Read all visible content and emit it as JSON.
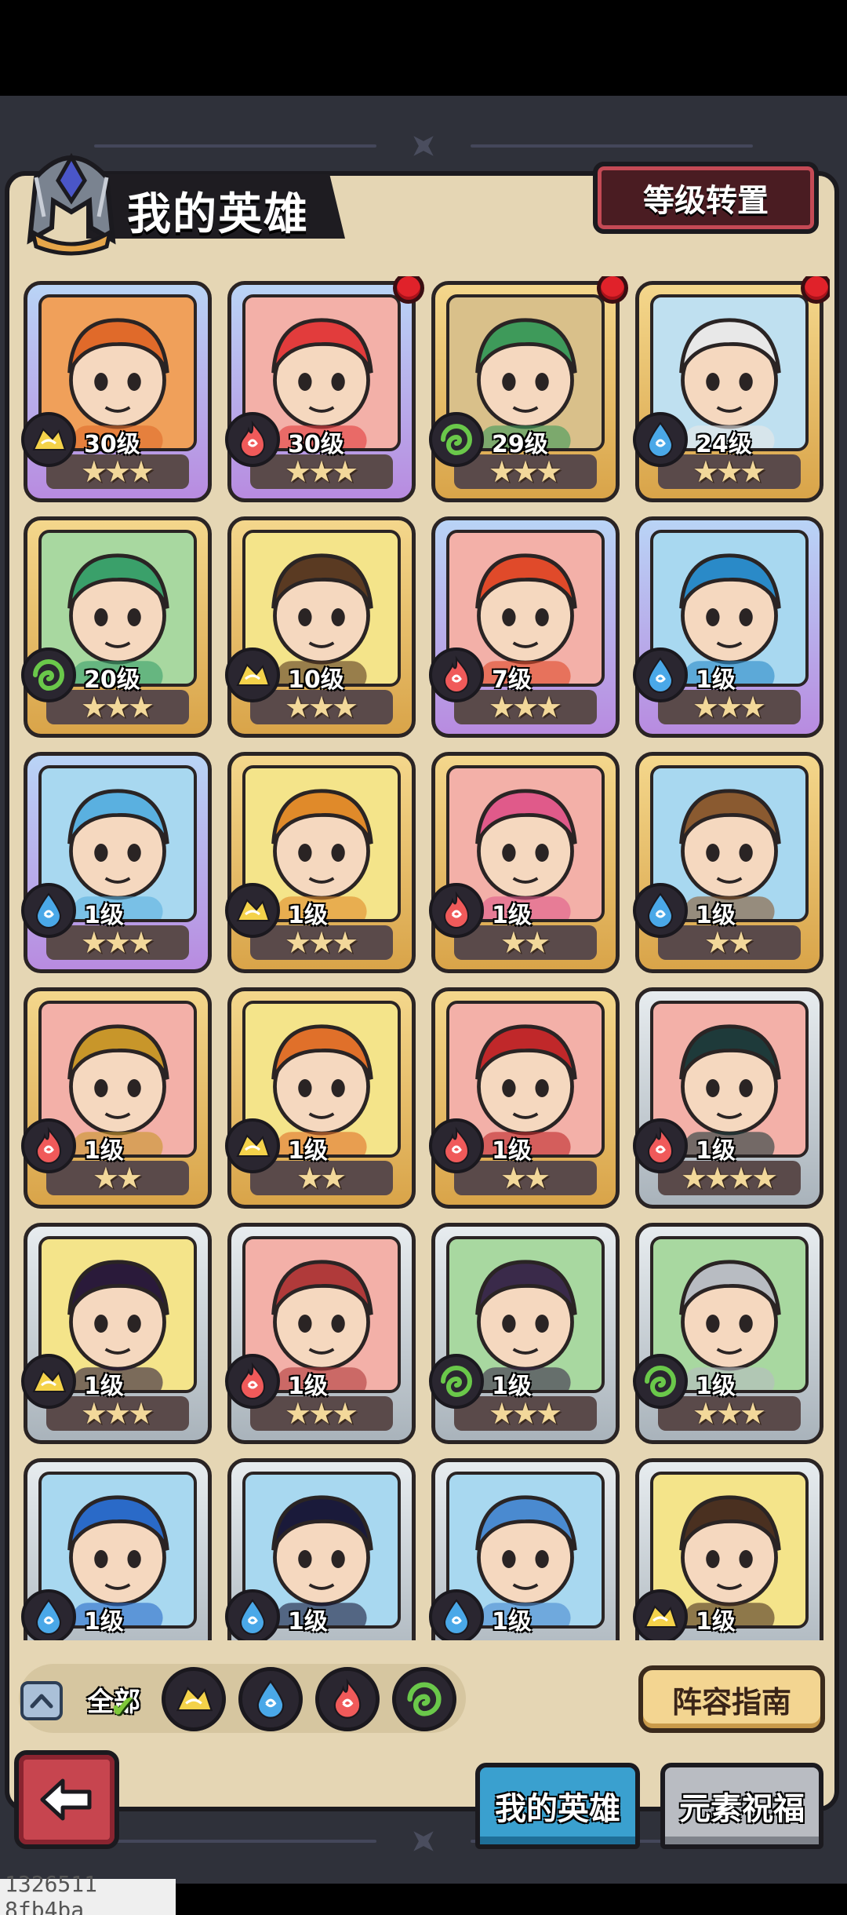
{
  "header": {
    "title": "我的英雄",
    "level_transfer_button": "等级转置"
  },
  "heroes": [
    {
      "level": "30级",
      "element": "earth",
      "stars": 3,
      "frame": "purple",
      "new_badge": false,
      "portrait_color": "#f0a05a",
      "hair_color": "#e06a2a"
    },
    {
      "level": "30级",
      "element": "fire",
      "stars": 3,
      "frame": "purple",
      "new_badge": true,
      "portrait_color": "#f3b0a8",
      "hair_color": "#e23c3c"
    },
    {
      "level": "29级",
      "element": "wind",
      "stars": 3,
      "frame": "gold",
      "new_badge": true,
      "portrait_color": "#d9c08a",
      "hair_color": "#3e9a5a"
    },
    {
      "level": "24级",
      "element": "water",
      "stars": 3,
      "frame": "gold",
      "new_badge": true,
      "portrait_color": "#bfe0f0",
      "hair_color": "#e8e8e8"
    },
    {
      "level": "20级",
      "element": "wind",
      "stars": 3,
      "frame": "gold",
      "new_badge": false,
      "portrait_color": "#a8d8a0",
      "hair_color": "#3aa06a"
    },
    {
      "level": "10级",
      "element": "earth",
      "stars": 3,
      "frame": "gold",
      "new_badge": false,
      "portrait_color": "#f4e48a",
      "hair_color": "#5a3a22"
    },
    {
      "level": "7级",
      "element": "fire",
      "stars": 3,
      "frame": "purple",
      "new_badge": false,
      "portrait_color": "#f3b0a8",
      "hair_color": "#e04a2a"
    },
    {
      "level": "1级",
      "element": "water",
      "stars": 3,
      "frame": "purple",
      "new_badge": false,
      "portrait_color": "#a8d8f0",
      "hair_color": "#2a8ac8"
    },
    {
      "level": "1级",
      "element": "water",
      "stars": 3,
      "frame": "purple",
      "new_badge": false,
      "portrait_color": "#a8d8f0",
      "hair_color": "#5ab0e0"
    },
    {
      "level": "1级",
      "element": "earth",
      "stars": 3,
      "frame": "gold",
      "new_badge": false,
      "portrait_color": "#f4e48a",
      "hair_color": "#e08a2a"
    },
    {
      "level": "1级",
      "element": "fire",
      "stars": 2,
      "frame": "gold",
      "new_badge": false,
      "portrait_color": "#f3b0a8",
      "hair_color": "#e05a8a"
    },
    {
      "level": "1级",
      "element": "water",
      "stars": 2,
      "frame": "gold",
      "new_badge": false,
      "portrait_color": "#a8d8f0",
      "hair_color": "#8a5a30"
    },
    {
      "level": "1级",
      "element": "fire",
      "stars": 2,
      "frame": "gold",
      "new_badge": false,
      "portrait_color": "#f3b0a8",
      "hair_color": "#c8962a"
    },
    {
      "level": "1级",
      "element": "earth",
      "stars": 2,
      "frame": "gold",
      "new_badge": false,
      "portrait_color": "#f4e48a",
      "hair_color": "#e0702a"
    },
    {
      "level": "1级",
      "element": "fire",
      "stars": 2,
      "frame": "gold",
      "new_badge": false,
      "portrait_color": "#f3b0a8",
      "hair_color": "#c0282a"
    },
    {
      "level": "1级",
      "element": "fire",
      "stars": 4,
      "frame": "silver",
      "new_badge": false,
      "portrait_color": "#f3b0a8",
      "hair_color": "#1e3a3a"
    },
    {
      "level": "1级",
      "element": "earth",
      "stars": 3,
      "frame": "silver",
      "new_badge": false,
      "portrait_color": "#f4e48a",
      "hair_color": "#2a1a3a"
    },
    {
      "level": "1级",
      "element": "fire",
      "stars": 3,
      "frame": "silver",
      "new_badge": false,
      "portrait_color": "#f3b0a8",
      "hair_color": "#b03a3a"
    },
    {
      "level": "1级",
      "element": "wind",
      "stars": 3,
      "frame": "silver",
      "new_badge": false,
      "portrait_color": "#a8d8a0",
      "hair_color": "#3a2a4a"
    },
    {
      "level": "1级",
      "element": "wind",
      "stars": 3,
      "frame": "silver",
      "new_badge": false,
      "portrait_color": "#a8d8a0",
      "hair_color": "#b8bcc2"
    },
    {
      "level": "1级",
      "element": "water",
      "stars": 0,
      "frame": "silver",
      "new_badge": false,
      "portrait_color": "#a8d8f0",
      "hair_color": "#2a6ac8"
    },
    {
      "level": "1级",
      "element": "water",
      "stars": 0,
      "frame": "silver",
      "new_badge": false,
      "portrait_color": "#a8d8f0",
      "hair_color": "#1a1a3a"
    },
    {
      "level": "1级",
      "element": "water",
      "stars": 0,
      "frame": "silver",
      "new_badge": false,
      "portrait_color": "#a8d8f0",
      "hair_color": "#4a8ad0"
    },
    {
      "level": "1级",
      "element": "earth",
      "stars": 0,
      "frame": "silver",
      "new_badge": false,
      "portrait_color": "#f4e48a",
      "hair_color": "#4a3020"
    }
  ],
  "filters": {
    "all_label": "全部",
    "elements": [
      "earth",
      "water",
      "fire",
      "wind"
    ],
    "selected": "all"
  },
  "lineup_guide_button": "阵容指南",
  "tabs": {
    "my_heroes": "我的英雄",
    "element_blessing": "元素祝福",
    "active": "my_heroes"
  },
  "element_colors": {
    "earth": "#f4d24a",
    "water": "#4aa8e8",
    "fire": "#f05a5a",
    "wind": "#6ac84a"
  },
  "icons": {
    "back": "back-arrow-icon",
    "collapse": "chevron-up-icon",
    "helmet": "helmet-emblem-icon"
  },
  "watermark": "1326511 8fb4ba"
}
